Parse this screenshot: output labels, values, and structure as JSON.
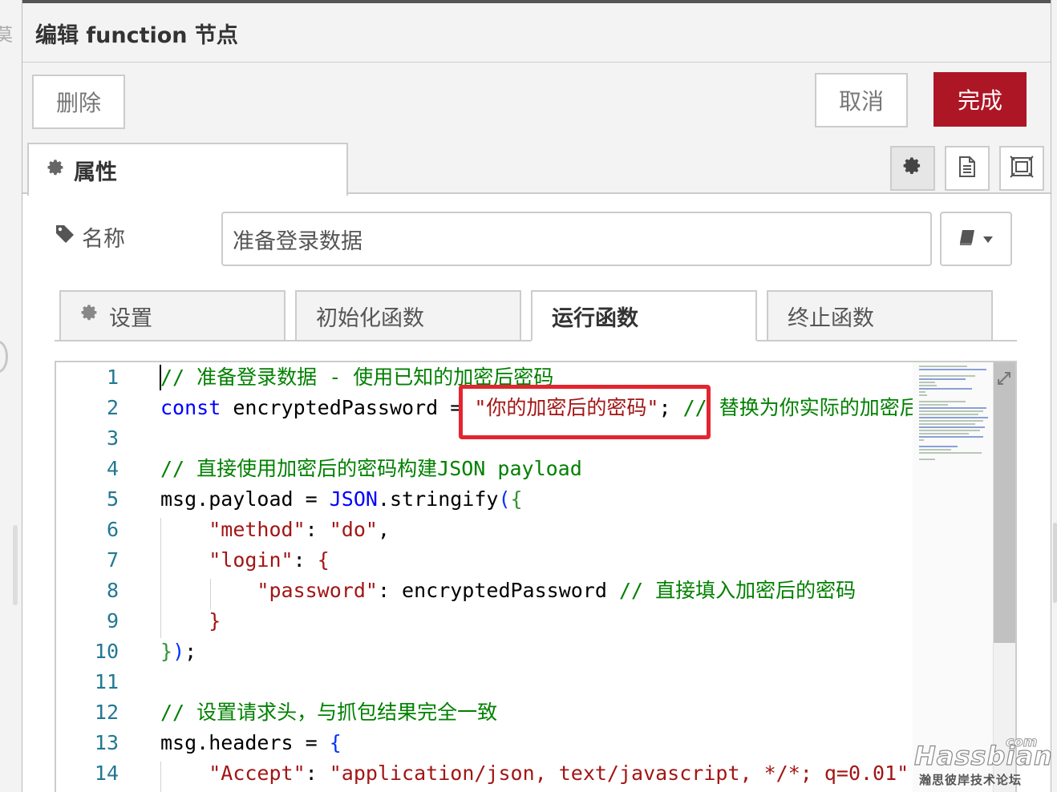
{
  "dialog": {
    "title": "编辑 function 节点",
    "delete_label": "删除",
    "cancel_label": "取消",
    "done_label": "完成",
    "accent_color": "#ad1625"
  },
  "properties_tab": {
    "label": "属性"
  },
  "name_field": {
    "label": "名称",
    "value": "准备登录数据"
  },
  "function_tabs": [
    {
      "label": "设置",
      "active": false
    },
    {
      "label": "初始化函数",
      "active": false
    },
    {
      "label": "运行函数",
      "active": true
    },
    {
      "label": "终止函数",
      "active": false
    }
  ],
  "editor": {
    "lines": [
      {
        "n": "1",
        "tokens": [
          {
            "t": "// 准备登录数据 - 使用已知的加密后密码",
            "c": "cm"
          }
        ]
      },
      {
        "n": "2",
        "tokens": [
          {
            "t": "const",
            "c": "kw"
          },
          {
            "t": " encryptedPassword = ",
            "c": ""
          },
          {
            "t": "\"你的加密后的密码\"",
            "c": "str"
          },
          {
            "t": "; ",
            "c": ""
          },
          {
            "t": "// 替换为你实际的加密后密码",
            "c": "cm"
          }
        ]
      },
      {
        "n": "3",
        "tokens": []
      },
      {
        "n": "4",
        "tokens": [
          {
            "t": "// 直接使用加密后的密码构建JSON payload",
            "c": "cm"
          }
        ]
      },
      {
        "n": "5",
        "tokens": [
          {
            "t": "msg.payload = ",
            "c": ""
          },
          {
            "t": "JSON",
            "c": "kw"
          },
          {
            "t": ".stringify",
            "c": ""
          },
          {
            "t": "(",
            "c": "br"
          },
          {
            "t": "{",
            "c": "br2"
          }
        ]
      },
      {
        "n": "6",
        "tokens": [
          {
            "t": "    ",
            "c": ""
          },
          {
            "t": "\"method\"",
            "c": "str"
          },
          {
            "t": ": ",
            "c": ""
          },
          {
            "t": "\"do\"",
            "c": "str"
          },
          {
            "t": ",",
            "c": ""
          }
        ]
      },
      {
        "n": "7",
        "tokens": [
          {
            "t": "    ",
            "c": ""
          },
          {
            "t": "\"login\"",
            "c": "str"
          },
          {
            "t": ": ",
            "c": ""
          },
          {
            "t": "{",
            "c": "str"
          }
        ]
      },
      {
        "n": "8",
        "tokens": [
          {
            "t": "        ",
            "c": ""
          },
          {
            "t": "\"password\"",
            "c": "str"
          },
          {
            "t": ": encryptedPassword ",
            "c": ""
          },
          {
            "t": "// 直接填入加密后的密码",
            "c": "cm"
          }
        ]
      },
      {
        "n": "9",
        "tokens": [
          {
            "t": "    ",
            "c": ""
          },
          {
            "t": "}",
            "c": "str"
          }
        ]
      },
      {
        "n": "10",
        "tokens": [
          {
            "t": "}",
            "c": "br2"
          },
          {
            "t": ")",
            "c": "br"
          },
          {
            "t": ";",
            "c": ""
          }
        ]
      },
      {
        "n": "11",
        "tokens": []
      },
      {
        "n": "12",
        "tokens": [
          {
            "t": "// 设置请求头，与抓包结果完全一致",
            "c": "cm"
          }
        ]
      },
      {
        "n": "13",
        "tokens": [
          {
            "t": "msg.headers = ",
            "c": ""
          },
          {
            "t": "{",
            "c": "br"
          }
        ]
      },
      {
        "n": "14",
        "tokens": [
          {
            "t": "    ",
            "c": ""
          },
          {
            "t": "\"Accept\"",
            "c": "str"
          },
          {
            "t": ": ",
            "c": ""
          },
          {
            "t": "\"application/json, text/javascript, */*; q=0.01\"",
            "c": "str"
          }
        ]
      }
    ]
  },
  "watermark": {
    "com": "com",
    "brand": "Hassbian",
    "subtitle": "瀚思彼岸技术论坛"
  },
  "background": {
    "left_char": "莫"
  }
}
